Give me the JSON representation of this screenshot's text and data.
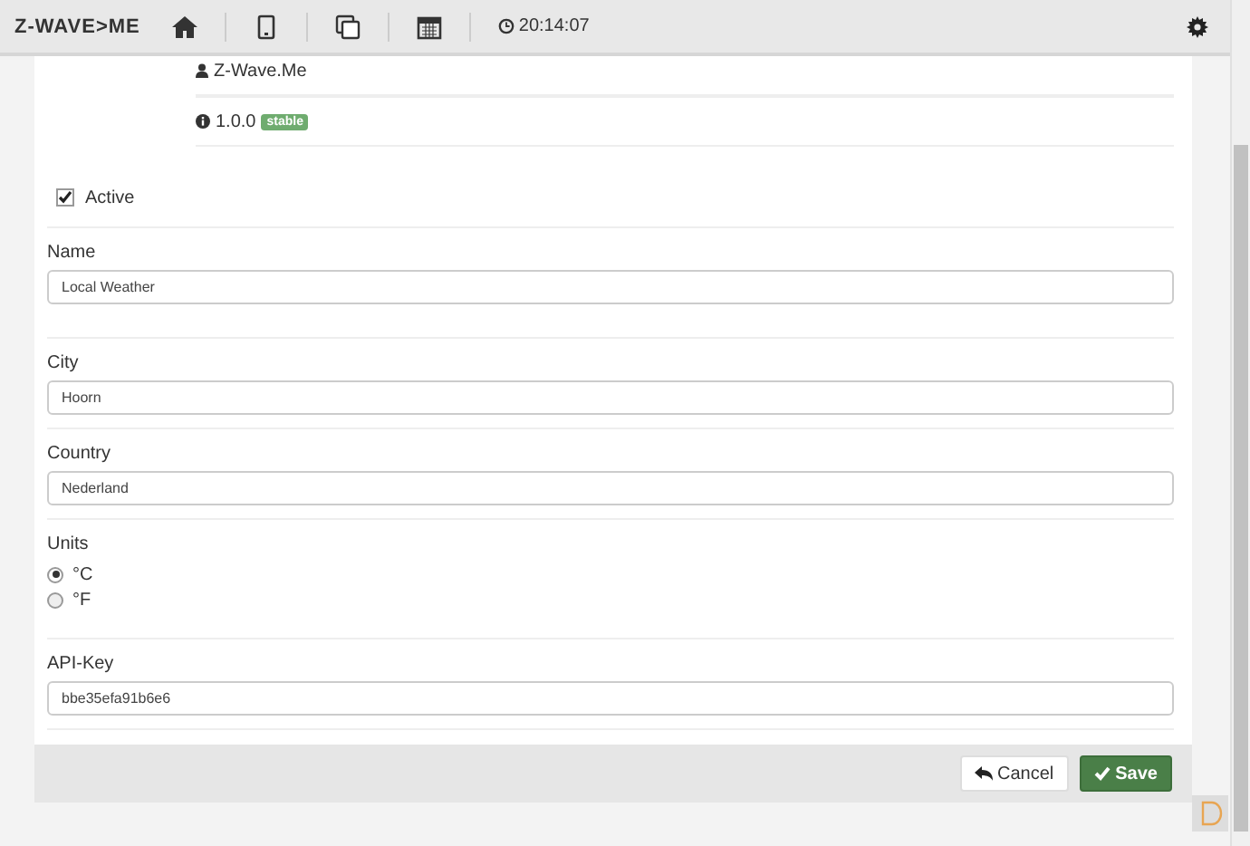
{
  "navbar": {
    "logo": "Z-WAVE>ME",
    "time": "20:14:07"
  },
  "app_info": {
    "author": "Z-Wave.Me",
    "version": "1.0.0",
    "badge": "stable"
  },
  "active": {
    "label": "Active",
    "checked": true
  },
  "fields": [
    {
      "kind": "text",
      "label": "Name",
      "value": "Local Weather"
    },
    {
      "kind": "text",
      "label": "City",
      "value": "Hoorn"
    },
    {
      "kind": "text",
      "label": "Country",
      "value": "Nederland"
    },
    {
      "kind": "radio",
      "label": "Units",
      "options": [
        {
          "label": "°C",
          "selected": true
        },
        {
          "label": "°F",
          "selected": false
        }
      ]
    },
    {
      "kind": "text",
      "label": "API-Key",
      "value": "bbe35efa91b6e6"
    }
  ],
  "buttons": [
    {
      "kind": "cancel",
      "label": "Cancel"
    },
    {
      "kind": "save",
      "label": "Save"
    }
  ]
}
